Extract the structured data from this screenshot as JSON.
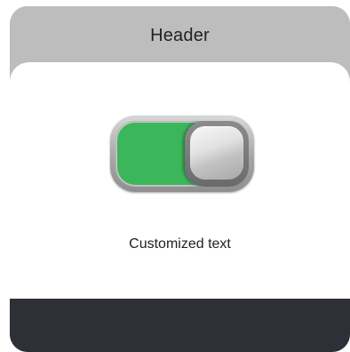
{
  "header": {
    "title": "Header"
  },
  "toggle": {
    "state": "on",
    "on_color": "#3cb65a"
  },
  "content": {
    "text": "Customized text"
  },
  "colors": {
    "header_bg": "#bdbdbd",
    "content_bg": "#ffffff",
    "footer_bg": "#2d3036"
  }
}
